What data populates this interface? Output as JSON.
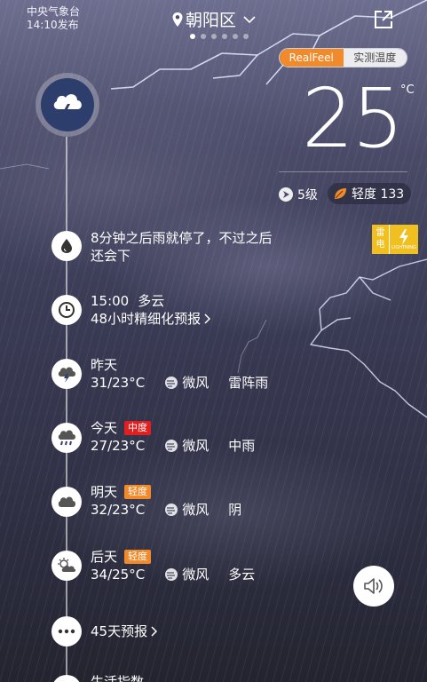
{
  "header": {
    "source": "中央气象台",
    "publish_time": "14:10发布",
    "city": "朝阳区",
    "pages": 6,
    "active_page": 1
  },
  "temp_toggle": {
    "options": [
      "RealFeel",
      "实测温度"
    ],
    "selected": "RealFeel"
  },
  "current": {
    "temperature": "25",
    "unit": "°C",
    "wind_level": "5级",
    "air_quality": "轻度 133",
    "icon": "thunderstorm-icon"
  },
  "alert": {
    "label": "雷电",
    "sub": "LIGHTNING"
  },
  "timeline": {
    "rain_notice": "8分钟之后雨就停了，不过之后",
    "rain_notice_2": "还会下",
    "hourly_time": "15:00",
    "hourly_cond": "多云",
    "hourly_link": "48小时精细化预报",
    "days": [
      {
        "name": "昨天",
        "badge": "",
        "temp": "31/23°C",
        "wind": "微风",
        "cond": "雷阵雨",
        "icon": "thunderstorm-icon"
      },
      {
        "name": "今天",
        "badge": "中度",
        "temp": "27/23°C",
        "wind": "微风",
        "cond": "中雨",
        "icon": "rain-icon"
      },
      {
        "name": "明天",
        "badge": "轻度",
        "temp": "32/23°C",
        "wind": "微风",
        "cond": "阴",
        "icon": "cloud-icon"
      },
      {
        "name": "后天",
        "badge": "轻度",
        "temp": "34/25°C",
        "wind": "微风",
        "cond": "多云",
        "icon": "partly-cloudy-icon"
      }
    ],
    "forecast_45": "45天预报",
    "life_index": "生活指数"
  },
  "colors": {
    "accent_orange": "#f08a2a",
    "badge_red": "#e02020",
    "icon_blue": "#2d3d6c",
    "lightning_yellow": "#f0c020"
  }
}
